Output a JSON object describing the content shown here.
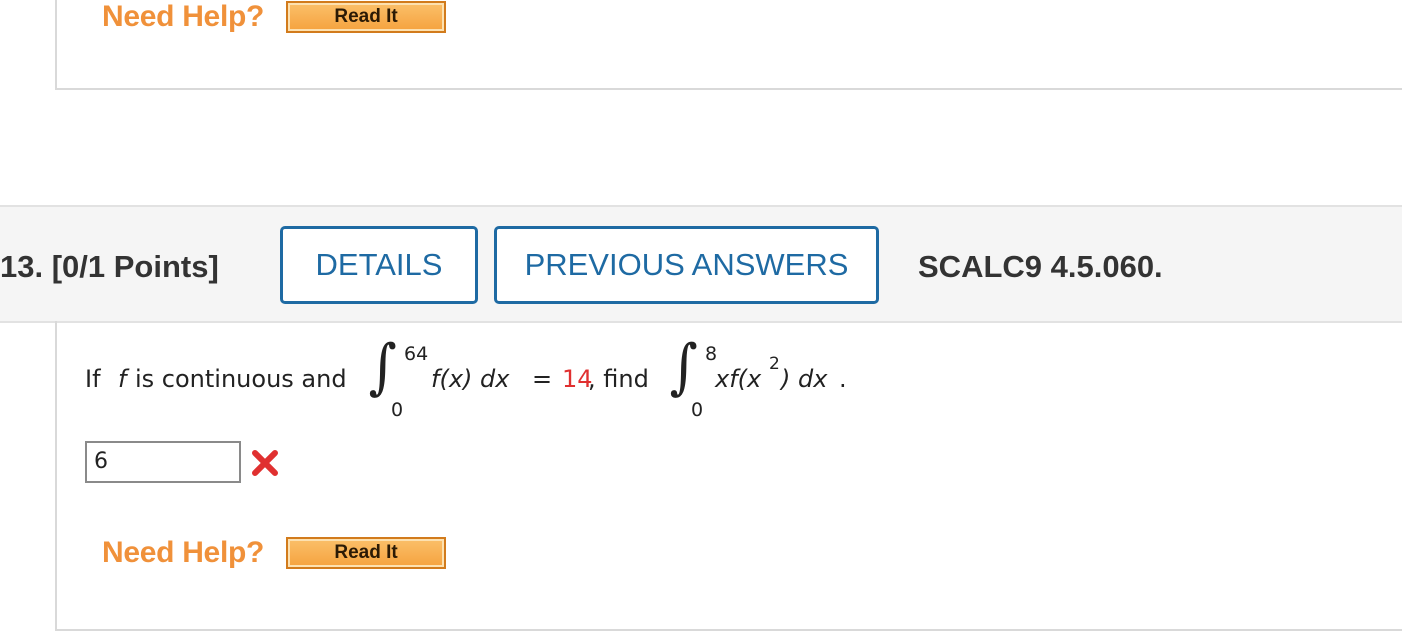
{
  "previous_question": {
    "need_help_label": "Need Help?",
    "read_it_label": "Read It"
  },
  "question": {
    "number_points": "13.  [0/1 Points]",
    "details_label": "DETAILS",
    "previous_answers_label": "PREVIOUS ANSWERS",
    "code": "SCALC9 4.5.060.",
    "statement": {
      "prefix_if": "If",
      "f_var": "f",
      "prefix_rest": "is continuous and",
      "int1_upper": "64",
      "int1_lower": "0",
      "int1_integrand": "f(x) dx",
      "equals": "=",
      "given_value": "14",
      "find_text": ", find",
      "int2_upper": "8",
      "int2_lower": "0",
      "int2_integrand_pre": "xf(x",
      "int2_exp": "2",
      "int2_integrand_post": ") dx",
      "period": "."
    },
    "answer_value": "6",
    "answer_status": "incorrect",
    "need_help_label": "Need Help?",
    "read_it_label": "Read It"
  },
  "colors": {
    "accent_blue": "#1e6aa3",
    "help_orange": "#f0913a",
    "error_red": "#e03030"
  },
  "icons": {
    "incorrect": "x-mark-icon"
  }
}
